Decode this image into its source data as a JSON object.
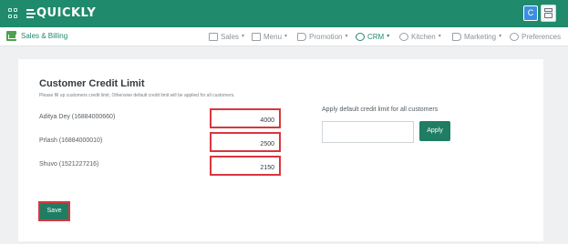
{
  "app": {
    "logo": "QUICKLY",
    "avatar_initial": "C"
  },
  "subnav": {
    "brand": "Sales & Billing",
    "menus": [
      {
        "label": "Sales",
        "icon": "sales-icon",
        "active": false
      },
      {
        "label": "Menu",
        "icon": "menu-icon",
        "active": false
      },
      {
        "label": "Promotion",
        "icon": "tag-icon",
        "active": false
      },
      {
        "label": "CRM",
        "icon": "crm-icon",
        "active": true
      },
      {
        "label": "Kitchen",
        "icon": "chef-icon",
        "active": false
      },
      {
        "label": "Marketing",
        "icon": "megaphone-icon",
        "active": false
      },
      {
        "label": "Preferences",
        "icon": "gear-icon",
        "active": false
      }
    ]
  },
  "page": {
    "title": "Customer Credit Limit",
    "note": "Please fill up customers credit limit, Otherwise default credit limit will be applied for all customers."
  },
  "customers": [
    {
      "name": "Aditya Dey (16884000660)",
      "limit": "4000"
    },
    {
      "name": "Prlash (16884000010)",
      "limit": "2500"
    },
    {
      "name": "Shuvo (1521227216)",
      "limit": "2150"
    }
  ],
  "default_limit": {
    "label": "Apply default credit limit for all customers",
    "value": "",
    "apply_label": "Apply"
  },
  "actions": {
    "save_label": "Save"
  },
  "colors": {
    "brand": "#1f8a6c",
    "button": "#1f7d63",
    "highlight": "#d9363e"
  }
}
